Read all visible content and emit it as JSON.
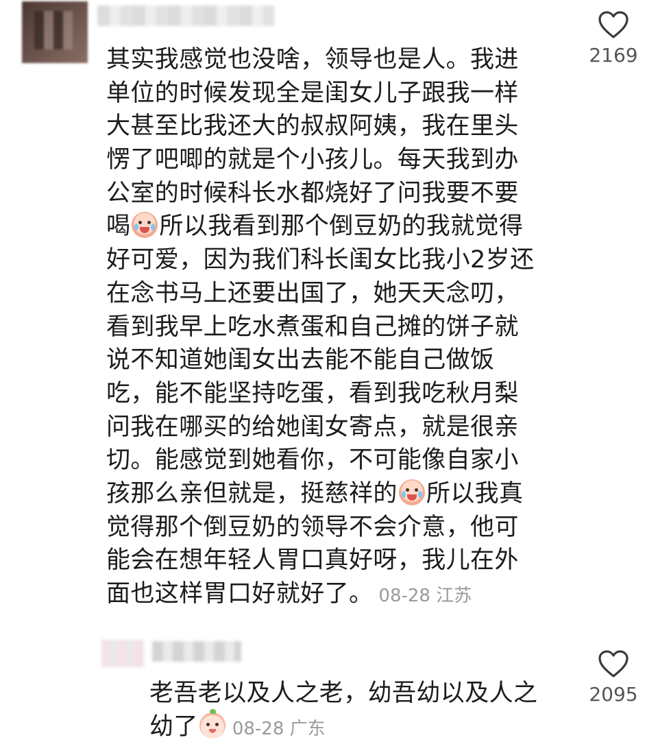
{
  "comment": {
    "lines": [
      "其实我感觉也没啥，领导也是人。我进",
      "单位的时候发现全是闺女儿子跟我一样",
      "大甚至比我还大的叔叔阿姨，我在里头",
      "愣了吧唧的就是个小孩儿。每天我到办",
      "公室的时候科长水都烧好了问我要不要",
      "喝",
      "所以我看到那个倒豆奶的我就觉得",
      "好可爱，因为我们科长闺女比我小2岁还",
      "在念书马上还要出国了，她天天念叨，",
      "看到我早上吃水煮蛋和自己摊的饼子就",
      "说不知道她闺女出去能不能自己做饭",
      "吃，能不能坚持吃蛋，看到我吃秋月梨",
      "问我在哪买的给她闺女寄点，就是很亲",
      "切。能感觉到她看你，不可能像自家小",
      "孩那么亲但就是，挺慈祥的",
      "所以我真",
      "觉得那个倒豆奶的领导不会介意，他可",
      "能会在想年轻人胃口真好呀，我儿在外",
      "面也这样胃口好就好了。"
    ],
    "meta": "08-28 江苏",
    "likes": "2169",
    "emojis": [
      "crying-face-emoji",
      "crying-face-emoji"
    ]
  },
  "reply": {
    "lines": [
      "老吾老以及人之老，幼吾幼以及人之",
      "幼了"
    ],
    "meta": "08-28 广东",
    "likes": "2095",
    "emojis": [
      "smiling-peach-emoji"
    ]
  }
}
